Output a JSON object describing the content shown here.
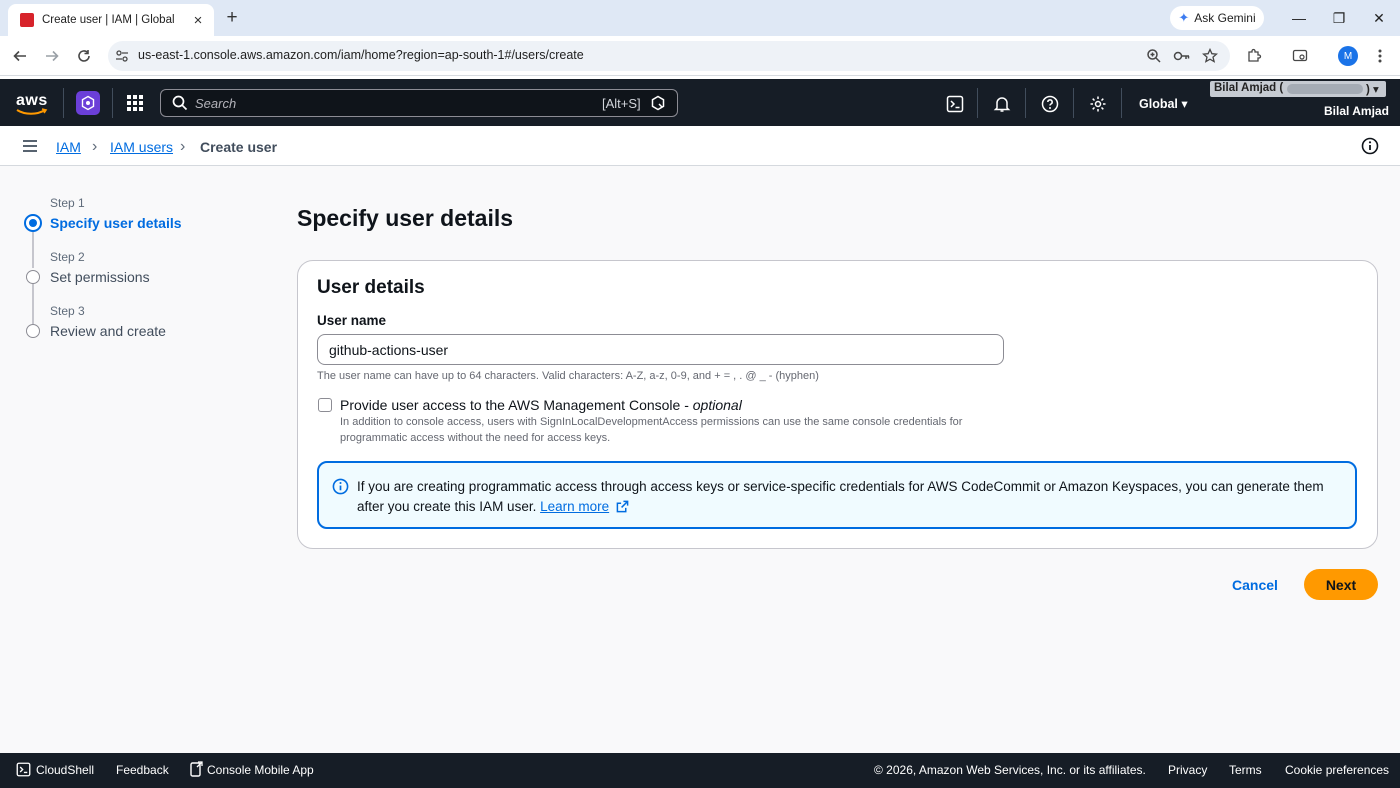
{
  "browser": {
    "tab_title": "Create user | IAM | Global",
    "tab_close": "×",
    "new_tab": "+",
    "url": "us-east-1.console.aws.amazon.com/iam/home?region=ap-south-1#/users/create",
    "gemini_label": "Ask Gemini",
    "profile_initial": "M",
    "window_minimize": "—",
    "window_restore": "❐",
    "window_close": "✕"
  },
  "aws_header": {
    "logo_text": "aws",
    "search_placeholder": "Search",
    "search_shortcut": "[Alt+S]",
    "region": "Global",
    "account_name": "Bilal Amjad (",
    "account_tail": ") ▾",
    "user_name": "Bilal Amjad"
  },
  "breadcrumbs": {
    "items": [
      "IAM",
      "IAM users"
    ],
    "current": "Create user",
    "separator": "›"
  },
  "steps": [
    {
      "label": "Step 1",
      "title": "Specify user details",
      "active": true
    },
    {
      "label": "Step 2",
      "title": "Set permissions",
      "active": false
    },
    {
      "label": "Step 3",
      "title": "Review and create",
      "active": false
    }
  ],
  "main": {
    "page_title": "Specify user details",
    "card_title": "User details",
    "username_label": "User name",
    "username_value": "github-actions-user",
    "username_hint": "The user name can have up to 64 characters. Valid characters: A-Z, a-z, 0-9, and + = , . @ _ - (hyphen)",
    "console_access_label": "Provide user access to the AWS Management Console - ",
    "console_access_optional": "optional",
    "console_access_checked": false,
    "console_access_desc": "In addition to console access, users with SignInLocalDevelopmentAccess permissions can use the same console credentials for programmatic access without the need for access keys.",
    "alert_text": "If you are creating programmatic access through access keys or service-specific credentials for AWS CodeCommit or Amazon Keyspaces, you can generate them after you create this IAM user. ",
    "alert_link": "Learn more",
    "cancel_label": "Cancel",
    "next_label": "Next"
  },
  "footer": {
    "cloudshell": "CloudShell",
    "feedback": "Feedback",
    "mobile_app": "Console Mobile App",
    "copyright": "© 2026, Amazon Web Services, Inc. or its affiliates.",
    "privacy": "Privacy",
    "terms": "Terms",
    "cookies": "Cookie preferences"
  },
  "colors": {
    "aws_nav": "#161d26",
    "link_blue": "#006ce0",
    "primary_orange": "#ff9900",
    "page_bg": "#f9f9fa"
  }
}
